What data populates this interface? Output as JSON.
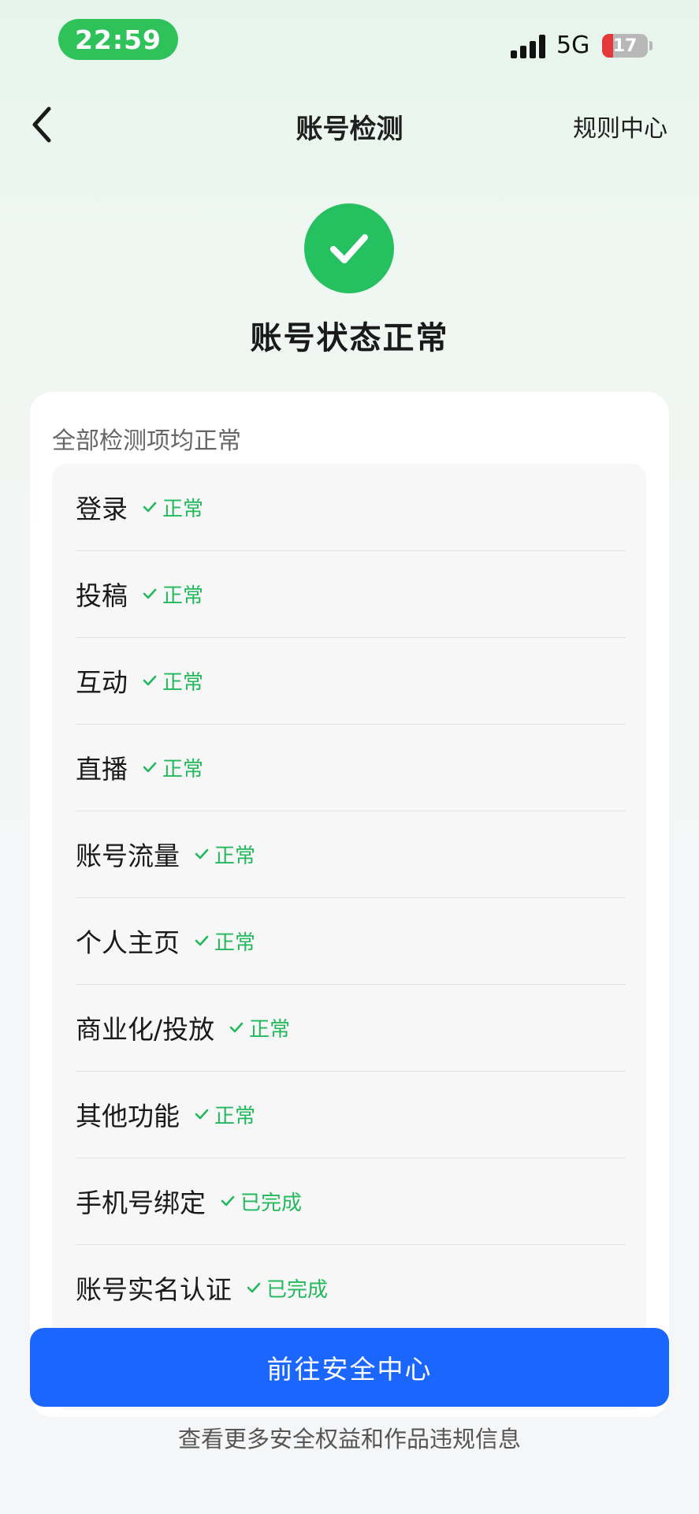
{
  "status_bar": {
    "time": "22:59",
    "network": "5G",
    "battery": "17"
  },
  "nav": {
    "title": "账号检测",
    "right_link": "规则中心"
  },
  "status": {
    "title": "账号状态正常"
  },
  "card": {
    "subtitle": "全部检测项均正常",
    "items": [
      {
        "label": "登录",
        "status": "正常"
      },
      {
        "label": "投稿",
        "status": "正常"
      },
      {
        "label": "互动",
        "status": "正常"
      },
      {
        "label": "直播",
        "status": "正常"
      },
      {
        "label": "账号流量",
        "status": "正常"
      },
      {
        "label": "个人主页",
        "status": "正常"
      },
      {
        "label": "商业化/投放",
        "status": "正常"
      },
      {
        "label": "其他功能",
        "status": "正常"
      },
      {
        "label": "手机号绑定",
        "status": "已完成"
      },
      {
        "label": "账号实名认证",
        "status": "已完成"
      }
    ]
  },
  "actions": {
    "primary_button": "前往安全中心",
    "footer_note": "查看更多安全权益和作品违规信息"
  },
  "colors": {
    "status_green": "#24b85c",
    "hero_green": "#25c160",
    "time_pill": "#2fc25b",
    "primary_blue": "#1b66ff",
    "battery_low": "#e5383b"
  },
  "icons": [
    "back-chevron-icon",
    "check-circle-icon",
    "check-icon",
    "signal-icon",
    "battery-icon"
  ]
}
